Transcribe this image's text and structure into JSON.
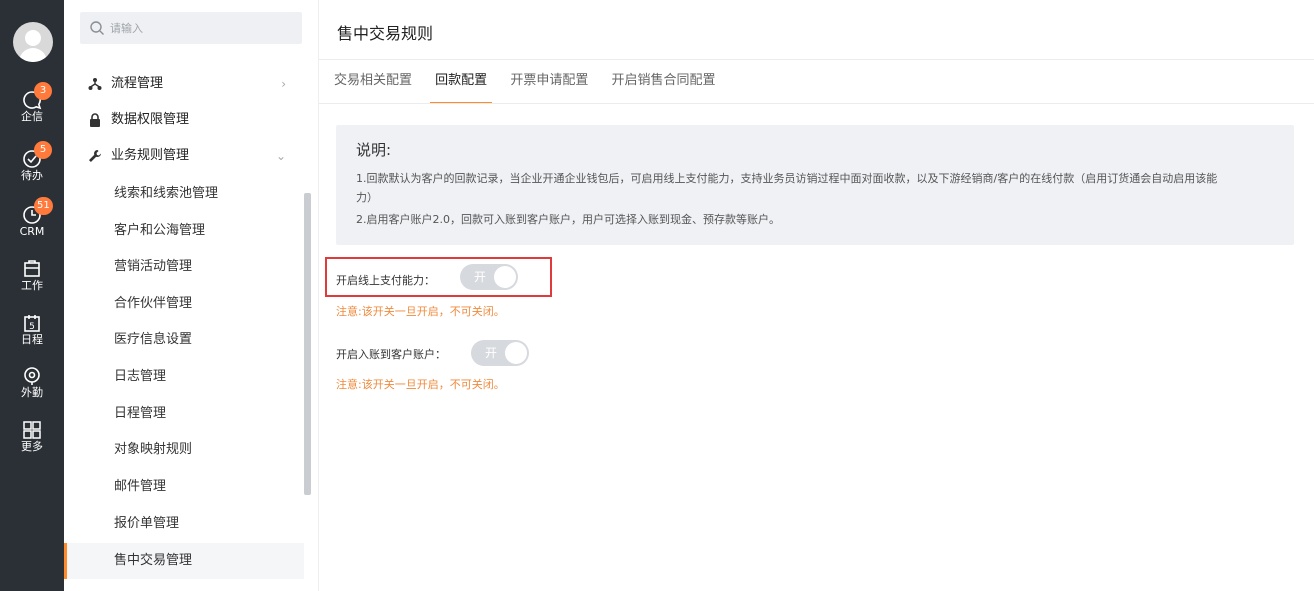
{
  "rail": {
    "items": [
      {
        "label": "企信",
        "icon": "chat-bubble-icon",
        "badge": "3"
      },
      {
        "label": "待办",
        "icon": "check-circle-icon",
        "badge": "5"
      },
      {
        "label": "CRM",
        "icon": "crm-clock-icon",
        "badge": "51"
      },
      {
        "label": "工作",
        "icon": "work-icon",
        "badge": ""
      },
      {
        "label": "日程",
        "icon": "calendar-icon",
        "calendar_day": "5",
        "badge": ""
      },
      {
        "label": "外勤",
        "icon": "location-pin-icon",
        "badge": ""
      },
      {
        "label": "更多",
        "icon": "grid-icon",
        "badge": ""
      }
    ]
  },
  "nav": {
    "search_placeholder": "请输入",
    "groups": [
      {
        "label": "流程管理",
        "icon": "flow-icon",
        "arrow": "›"
      },
      {
        "label": "数据权限管理",
        "icon": "lock-icon"
      },
      {
        "label": "业务规则管理",
        "icon": "wrench-icon",
        "arrow": "⌄"
      }
    ],
    "sub_items": [
      "线索和线索池管理",
      "客户和公海管理",
      "营销活动管理",
      "合作伙伴管理",
      "医疗信息设置",
      "日志管理",
      "日程管理",
      "对象映射规则",
      "邮件管理",
      "报价单管理",
      "售中交易管理"
    ],
    "active_item": "售中交易管理"
  },
  "main": {
    "title": "售中交易规则",
    "tabs": [
      "交易相关配置",
      "回款配置",
      "开票申请配置",
      "开启销售合同配置"
    ],
    "active_tab": "回款配置",
    "note": {
      "title": "说明:",
      "line1": "1.回款默认为客户的回款记录，当企业开通企业钱包后，可启用线上支付能力，支持业务员访销过程中面对面收款，以及下游经销商/客户的在线付款（启用订货通会自动启用该能",
      "line1b": "力）",
      "line2": "2.启用客户账户2.0，回款可入账到客户账户，用户可选择入账到现金、预存款等账户。"
    },
    "options": [
      {
        "label": "开启线上支付能力：",
        "toggle_text": "开",
        "warning": "注意:该开关一旦开启，不可关闭。"
      },
      {
        "label": "开启入账到客户账户：",
        "toggle_text": "开",
        "warning": "注意:该开关一旦开启，不可关闭。"
      }
    ]
  },
  "colors": {
    "accent": "#ff8b2c",
    "rail_bg": "#2b3036",
    "badge": "#ff7a3b",
    "warning_text": "#f08a3c",
    "highlight_border": "#e03b3b"
  }
}
